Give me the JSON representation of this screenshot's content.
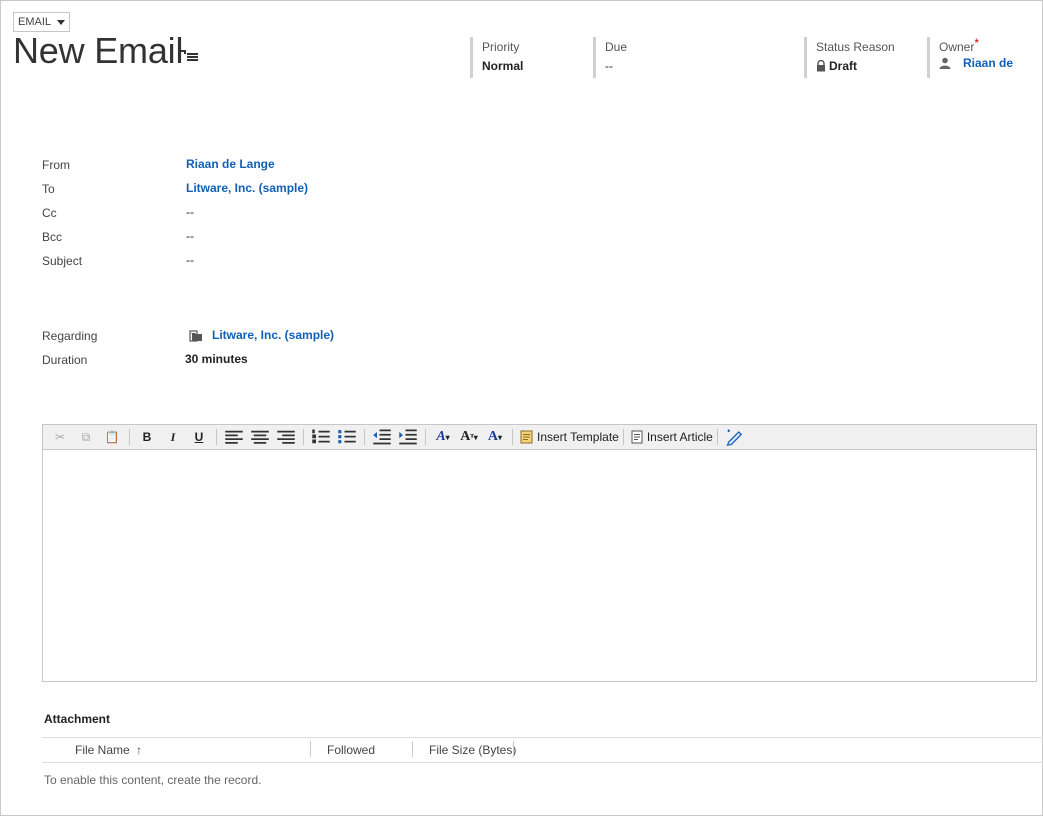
{
  "entity_selector": {
    "label": "EMAIL"
  },
  "title": "New Email",
  "header": {
    "priority": {
      "label": "Priority",
      "value": "Normal"
    },
    "due": {
      "label": "Due",
      "value": "--"
    },
    "status_reason": {
      "label": "Status Reason",
      "value": "Draft"
    },
    "owner": {
      "label": "Owner",
      "required_mark": "*",
      "value": "Riaan de"
    }
  },
  "fields": [
    {
      "label": "From",
      "value": "Riaan de Lange",
      "link": true
    },
    {
      "label": "To",
      "value": "Litware, Inc. (sample)",
      "link": true
    },
    {
      "label": "Cc",
      "value": "--",
      "link": false
    },
    {
      "label": "Bcc",
      "value": "--",
      "link": false
    },
    {
      "label": "Subject",
      "value": "--",
      "link": false
    }
  ],
  "regarding": {
    "label": "Regarding",
    "value": "Litware, Inc. (sample)"
  },
  "duration": {
    "label": "Duration",
    "value": "30 minutes"
  },
  "toolbar": {
    "bold": "B",
    "italic": "I",
    "underline": "U",
    "insert_template": "Insert Template",
    "insert_article": "Insert Article"
  },
  "attachment": {
    "title": "Attachment",
    "columns": [
      "File Name",
      "Followed",
      "File Size (Bytes)"
    ],
    "sort_indicator": "↑",
    "empty_message": "To enable this content, create the record."
  },
  "colors": {
    "link": "#1160b7",
    "required": "#dd0000",
    "toolbar_bg": "#f0f0f0"
  }
}
